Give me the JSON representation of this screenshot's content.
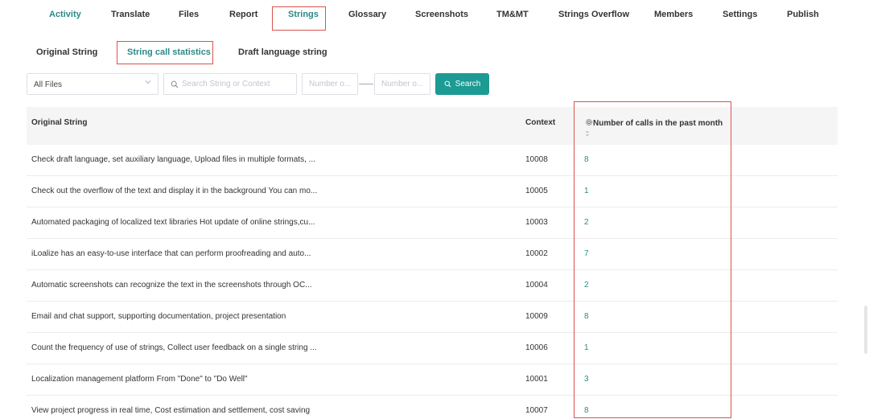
{
  "nav": {
    "items": [
      "Activity",
      "Translate",
      "Files",
      "Report",
      "Strings",
      "Glossary",
      "Screenshots",
      "TM&MT",
      "Strings Overflow",
      "Members",
      "Settings",
      "Publish"
    ],
    "active": "Strings"
  },
  "subtabs": {
    "items": [
      "Original String",
      "String call statistics",
      "Draft language string"
    ],
    "active": "String call statistics"
  },
  "filters": {
    "file_select": "All Files",
    "search_placeholder": "Search String or Context",
    "num_from_placeholder": "Number o...",
    "num_to_placeholder": "Number o...",
    "search_button": "Search"
  },
  "table": {
    "headers": {
      "original": "Original String",
      "context": "Context",
      "calls": "Number of calls in the past month"
    },
    "rows": [
      {
        "original": "Check draft language, set auxiliary language, Upload files in multiple formats, ...",
        "context": "10008",
        "calls": "8"
      },
      {
        "original": "Check out the overflow of the text and display it in the background You can mo...",
        "context": "10005",
        "calls": "1"
      },
      {
        "original": "Automated packaging of localized text libraries Hot update of online strings,cu...",
        "context": "10003",
        "calls": "2"
      },
      {
        "original": "iLoalize has an easy-to-use interface that can perform proofreading and auto...",
        "context": "10002",
        "calls": "7"
      },
      {
        "original": "Automatic screenshots can recognize the text in the screenshots through OC...",
        "context": "10004",
        "calls": "2"
      },
      {
        "original": "Email and chat support, supporting documentation, project presentation",
        "context": "10009",
        "calls": "8"
      },
      {
        "original": "Count the frequency of use of strings, Collect user feedback on a single string ...",
        "context": "10006",
        "calls": "1"
      },
      {
        "original": "Localization management platform From \"Done\" to \"Do Well\"",
        "context": "10001",
        "calls": "3"
      },
      {
        "original": "View project progress in real time, Cost estimation and settlement, cost saving",
        "context": "10007",
        "calls": "8"
      }
    ]
  },
  "colors": {
    "accent": "#1c9a94",
    "highlight": "#d9534f"
  }
}
